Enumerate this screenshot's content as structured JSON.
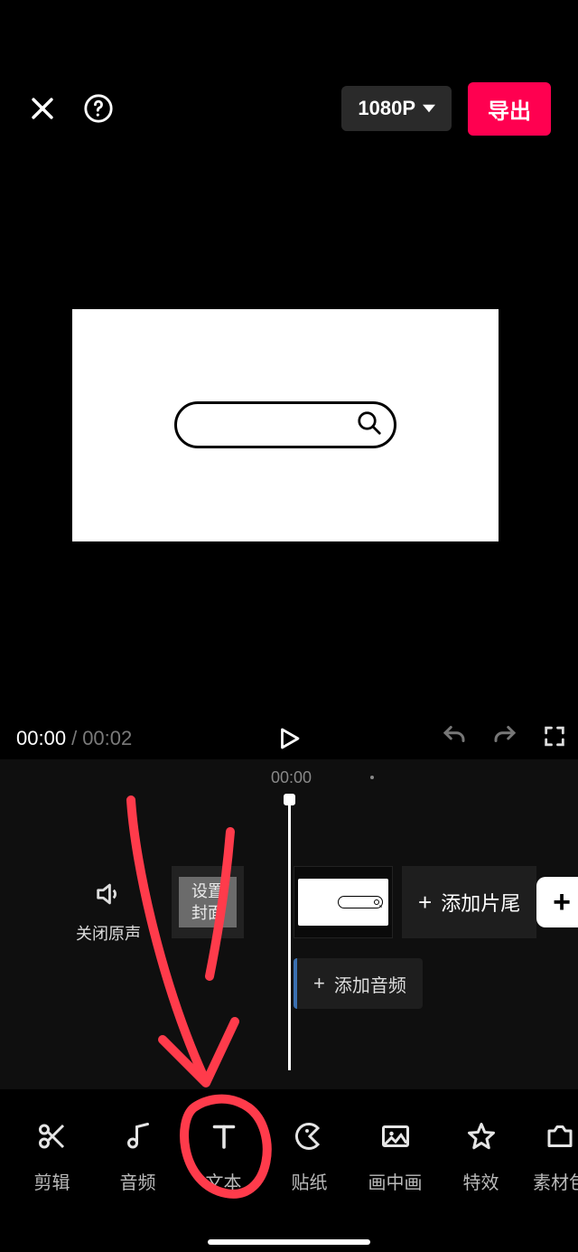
{
  "header": {
    "resolution_label": "1080P",
    "export_label": "导出"
  },
  "playback": {
    "current_time": "00:00",
    "total_time": "00:02"
  },
  "timeline": {
    "ruler_zero": "00:00",
    "mute_label": "关闭原声",
    "cover_label": "设置\n封面",
    "add_tail_label": "添加片尾",
    "add_audio_label": "添加音频"
  },
  "toolbar": {
    "items": [
      {
        "id": "edit",
        "label": "剪辑"
      },
      {
        "id": "audio",
        "label": "音频"
      },
      {
        "id": "text",
        "label": "文本"
      },
      {
        "id": "sticker",
        "label": "贴纸"
      },
      {
        "id": "pip",
        "label": "画中画"
      },
      {
        "id": "effect",
        "label": "特效"
      },
      {
        "id": "material",
        "label": "素材包"
      }
    ]
  },
  "icons": {
    "close": "close-icon",
    "help": "help-icon",
    "chevron_down": "chevron-down-icon",
    "play": "play-icon",
    "undo": "undo-icon",
    "redo": "redo-icon",
    "fullscreen": "fullscreen-icon",
    "speaker": "speaker-icon",
    "plus": "plus-icon",
    "scissors": "scissors-icon",
    "music": "music-icon",
    "text": "text-icon",
    "pacman": "sticker-icon",
    "pip": "pip-icon",
    "star": "star-icon",
    "box": "material-icon",
    "search": "search-icon"
  },
  "colors": {
    "accent": "#ff0050",
    "bg": "#000000",
    "panel": "#1e1e1e",
    "annotation": "#ff3b4b"
  }
}
